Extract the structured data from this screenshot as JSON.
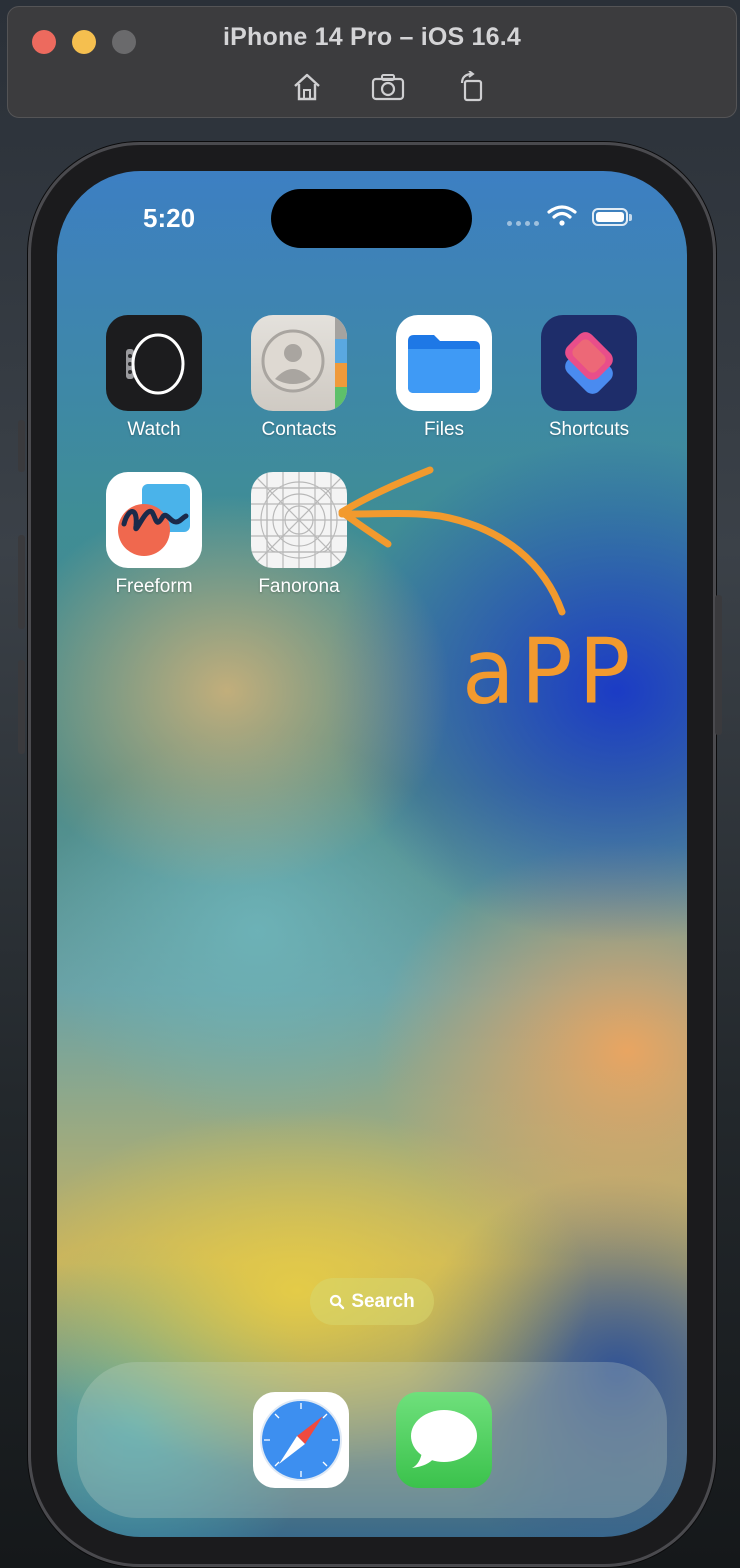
{
  "window": {
    "title": "iPhone 14 Pro – iOS 16.4",
    "toolbar": [
      {
        "name": "home-icon"
      },
      {
        "name": "screenshot-icon"
      },
      {
        "name": "rotate-icon"
      }
    ]
  },
  "status_bar": {
    "time": "5:20"
  },
  "home_apps": [
    {
      "label": "Watch",
      "icon": "watch-icon"
    },
    {
      "label": "Contacts",
      "icon": "contacts-icon"
    },
    {
      "label": "Files",
      "icon": "files-icon"
    },
    {
      "label": "Shortcuts",
      "icon": "shortcuts-icon"
    },
    {
      "label": "Freeform",
      "icon": "freeform-icon"
    },
    {
      "label": "Fanorona",
      "icon": "app-placeholder-icon"
    }
  ],
  "search": {
    "label": "Search"
  },
  "dock": [
    {
      "icon": "safari-icon"
    },
    {
      "icon": "messages-icon"
    }
  ],
  "annotation": {
    "text": "aPP",
    "color": "#f29a2e"
  },
  "colors": {
    "annotation": "#f29a2e",
    "files_blue": "#1e78e6",
    "messages_green": "#4fd15e"
  }
}
